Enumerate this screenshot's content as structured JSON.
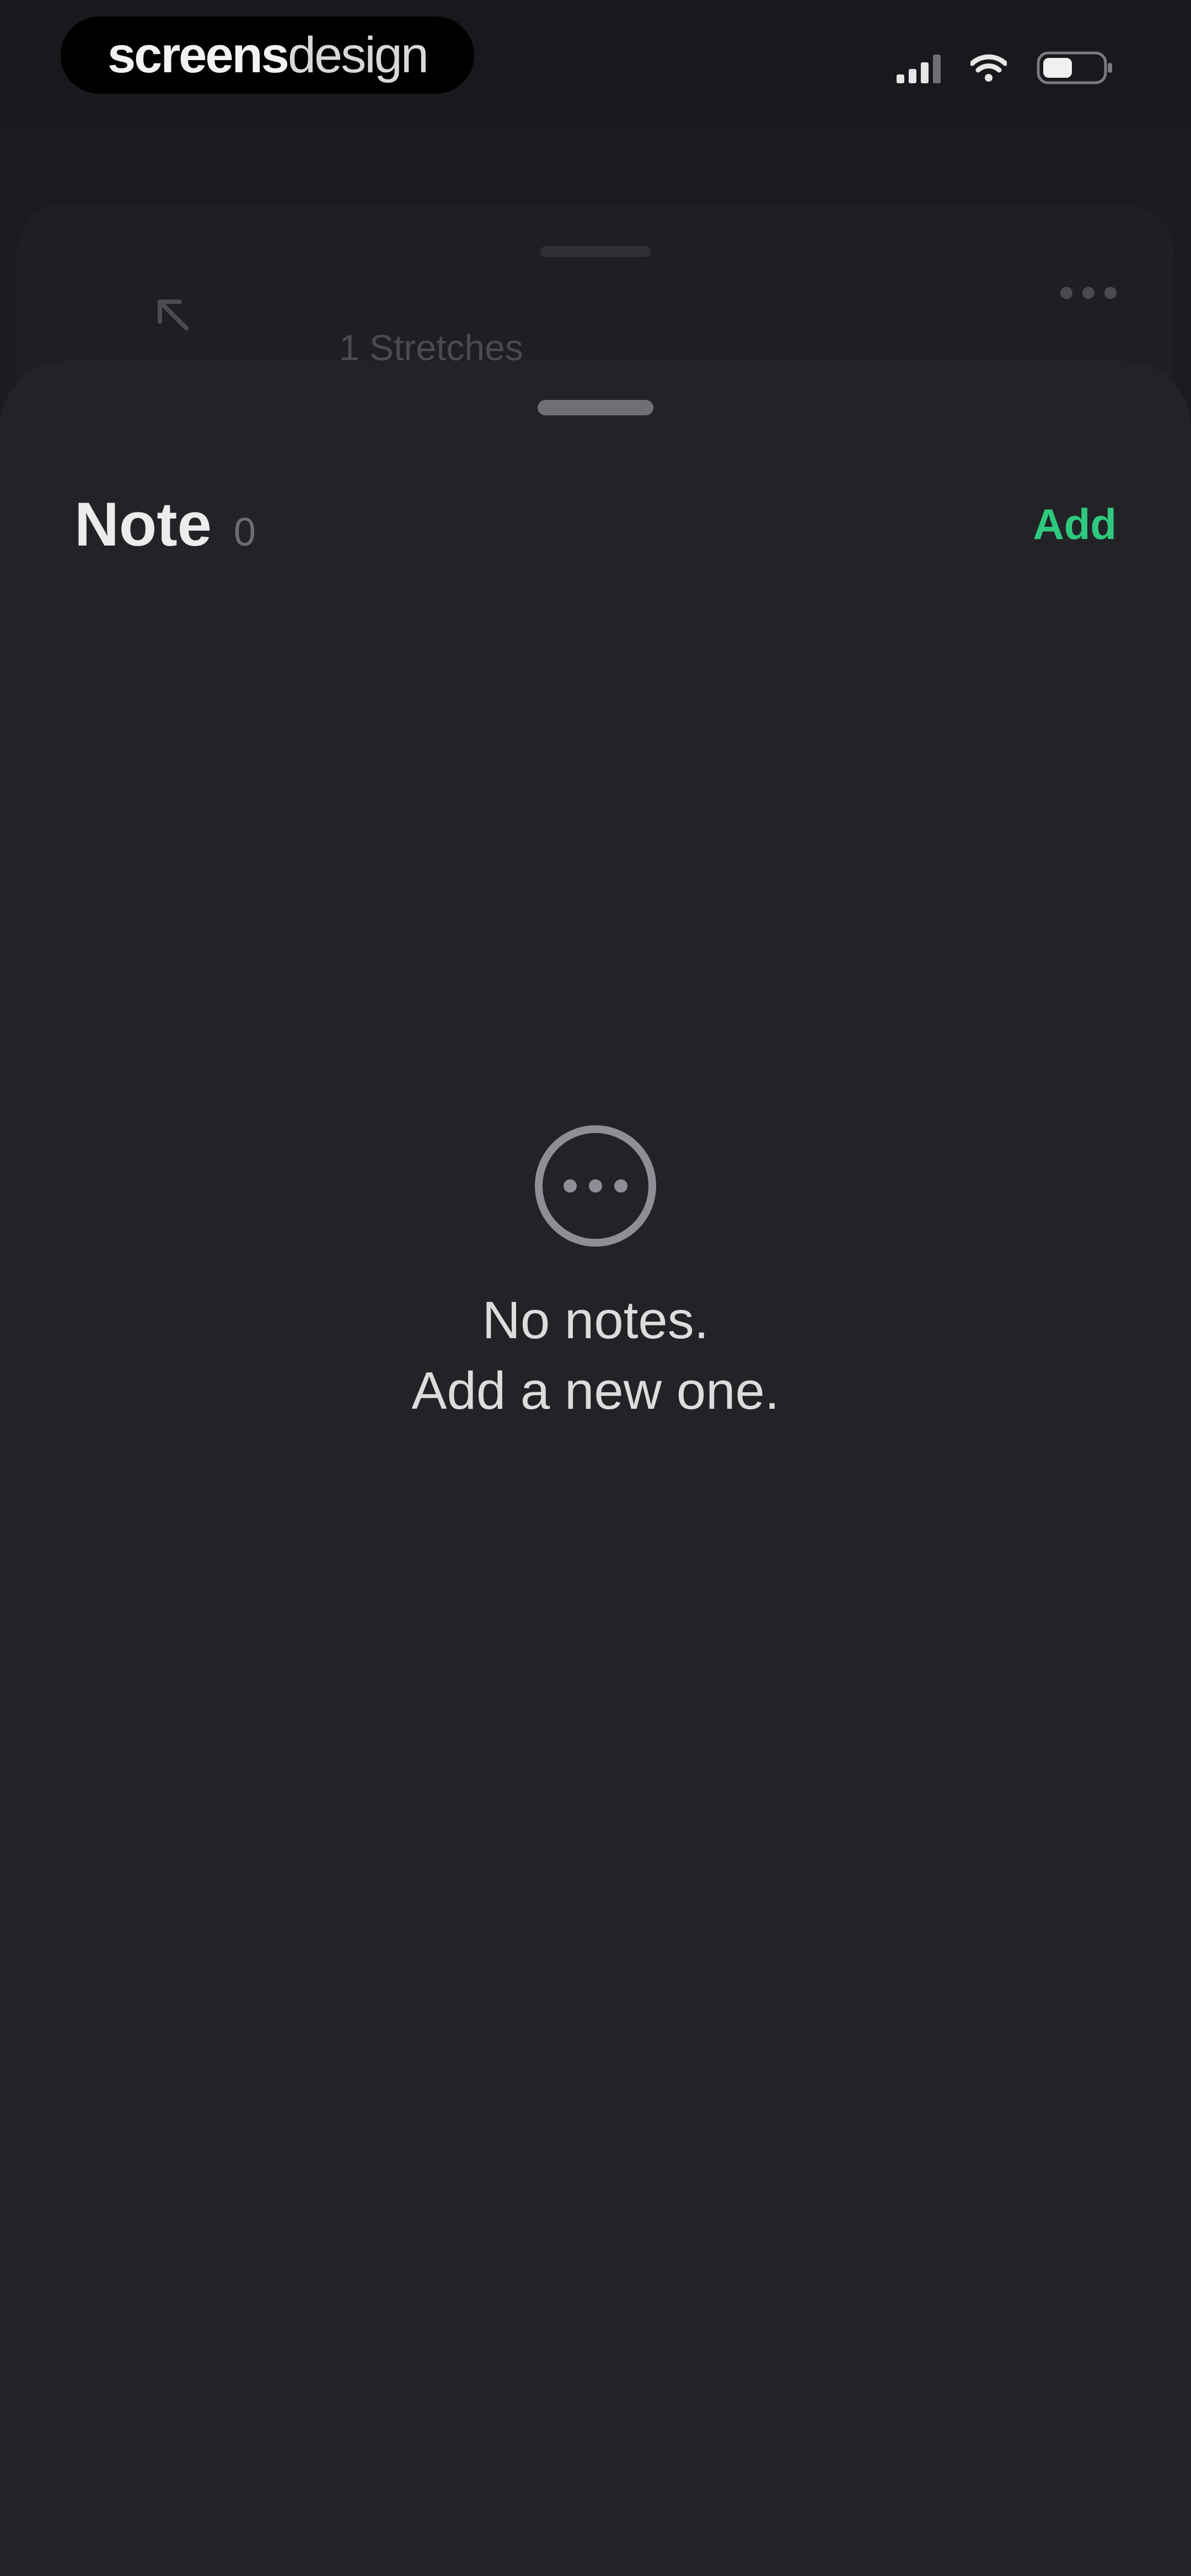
{
  "status_bar": {
    "brand_bold": "screens",
    "brand_light": "design"
  },
  "underlying_page": {
    "subtitle": "1 Stretches"
  },
  "sheet": {
    "title": "Note",
    "count": "0",
    "add_label": "Add"
  },
  "empty_state": {
    "line1": "No notes.",
    "line2": "Add a new one."
  },
  "colors": {
    "background": "#1a1b1f",
    "sheet": "#222327",
    "accent": "#2ec97e",
    "text": "#ececec",
    "muted": "#6c6d71"
  },
  "icons": {
    "collapse": "arrow-up-left-icon",
    "more": "more-horizontal-icon",
    "empty": "ellipsis-circle-icon"
  }
}
